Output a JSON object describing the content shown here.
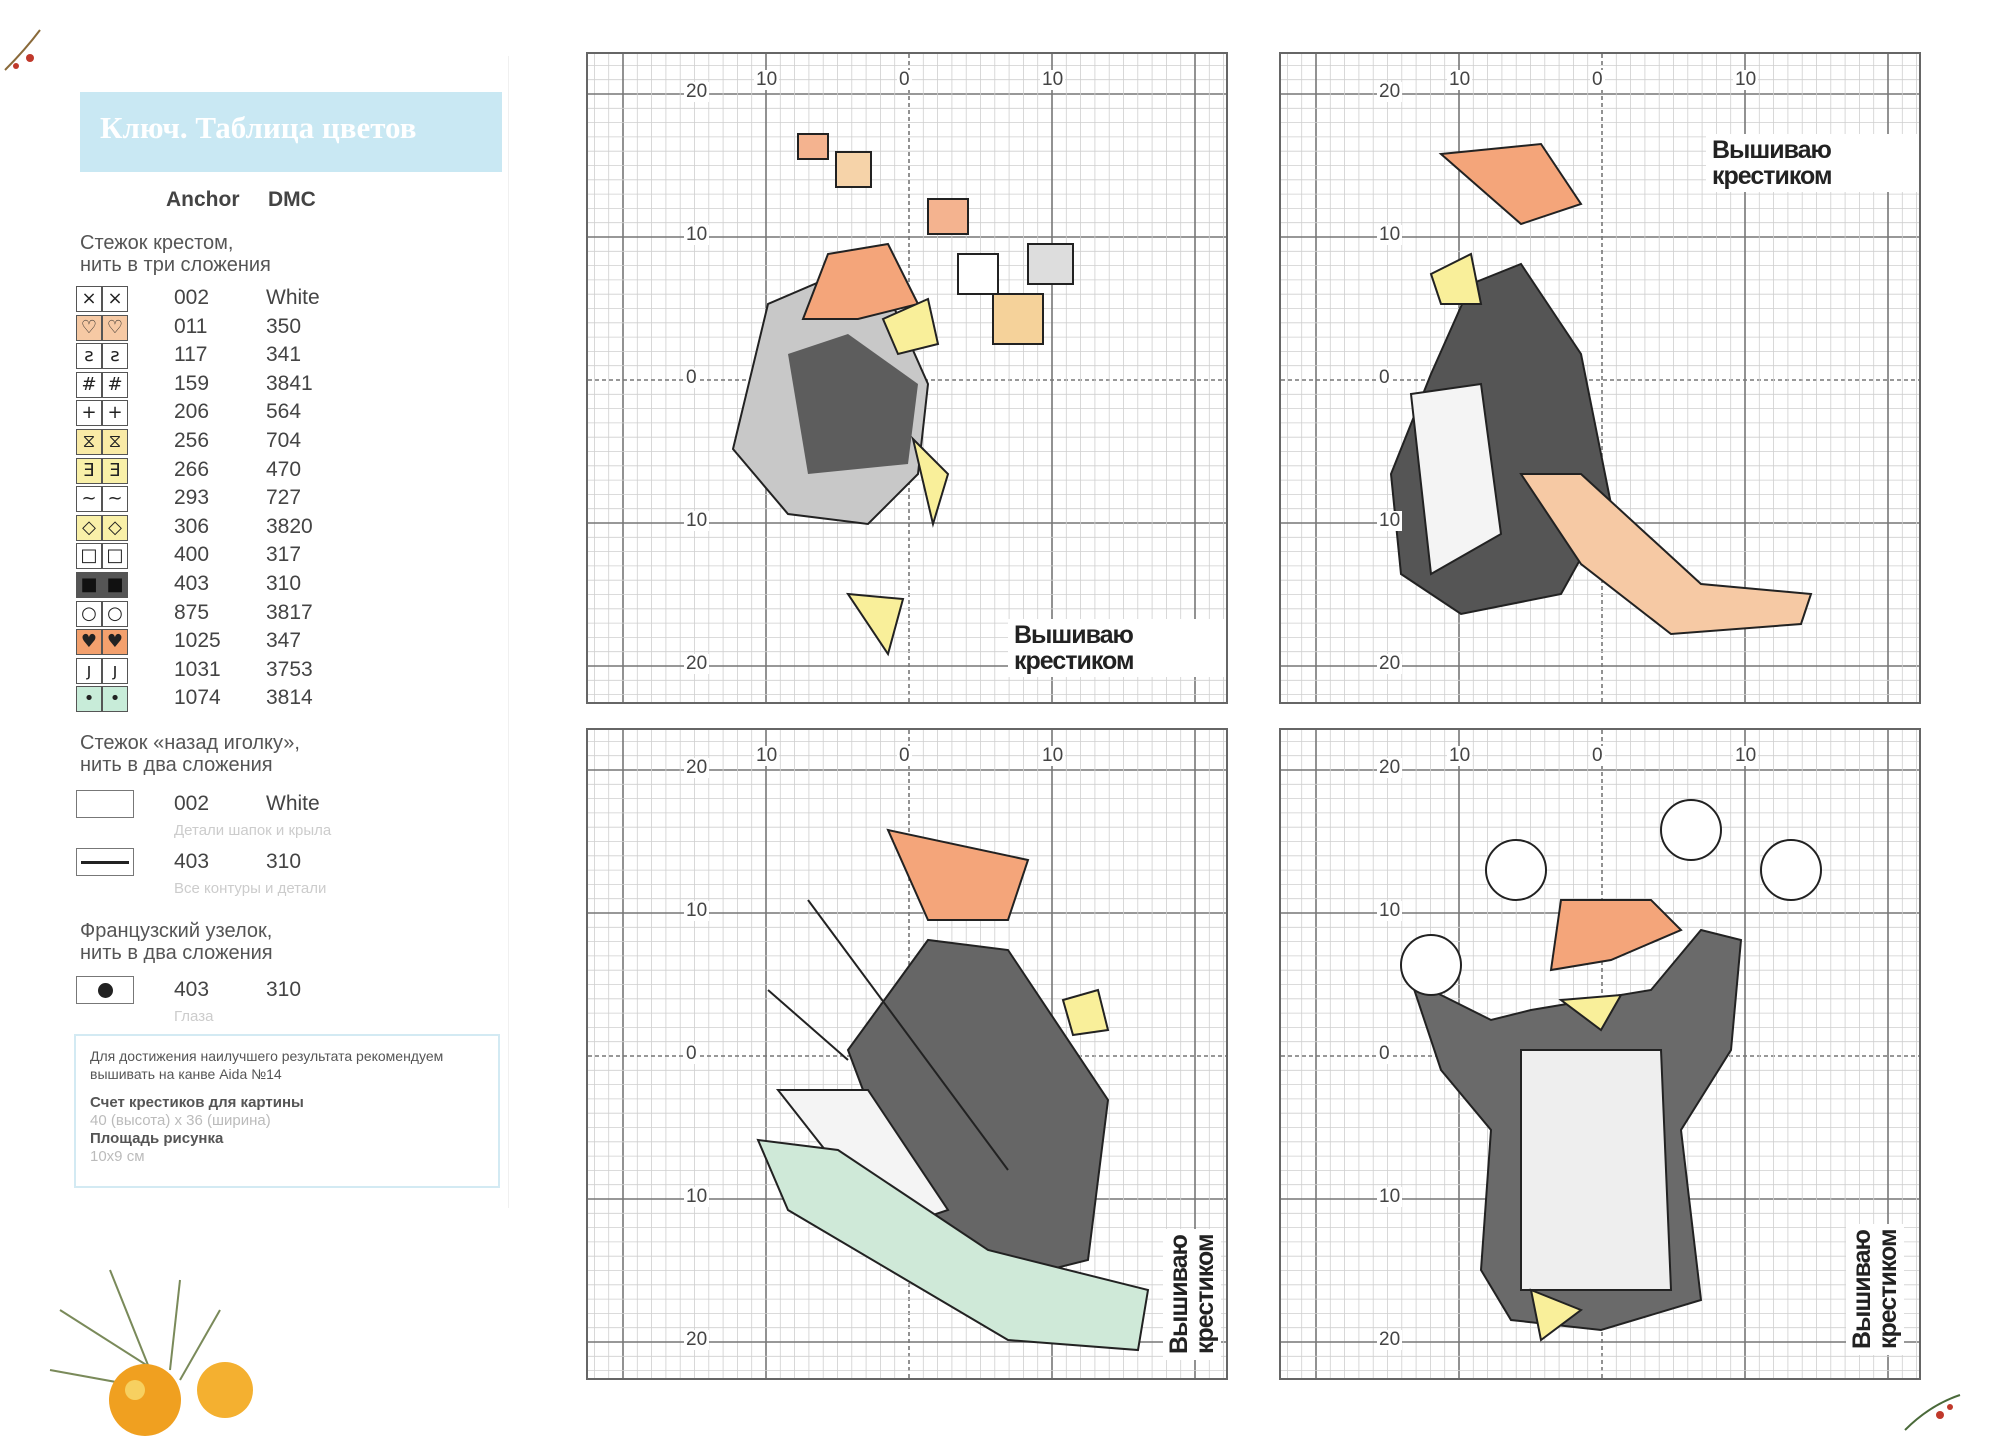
{
  "key": {
    "title": "Ключ. Таблица цветов",
    "col_anchor": "Anchor",
    "col_dmc": "DMC",
    "cross_heading_1": "Стежок крестом,",
    "cross_heading_2": "нить в три сложения",
    "rows": [
      {
        "sym": "×",
        "bg": "#ffffff",
        "anchor": "002",
        "dmc": "White"
      },
      {
        "sym": "♡",
        "bg": "#f6c9a4",
        "anchor": "011",
        "dmc": "350"
      },
      {
        "sym": "ƨ",
        "bg": "#ffffff",
        "anchor": "117",
        "dmc": "341"
      },
      {
        "sym": "#",
        "bg": "#ffffff",
        "anchor": "159",
        "dmc": "3841"
      },
      {
        "sym": "+",
        "bg": "#ffffff",
        "anchor": "206",
        "dmc": "564"
      },
      {
        "sym": "⧖",
        "bg": "#f9eaa6",
        "anchor": "256",
        "dmc": "704"
      },
      {
        "sym": "Ǝ",
        "bg": "#f9f0a8",
        "anchor": "266",
        "dmc": "470"
      },
      {
        "sym": "~",
        "bg": "#ffffff",
        "anchor": "293",
        "dmc": "727"
      },
      {
        "sym": "◇",
        "bg": "#f9f0a8",
        "anchor": "306",
        "dmc": "3820"
      },
      {
        "sym": "□",
        "bg": "#ffffff",
        "anchor": "400",
        "dmc": "317"
      },
      {
        "sym": "■",
        "bg": "#555555",
        "anchor": "403",
        "dmc": "310"
      },
      {
        "sym": "○",
        "bg": "#ffffff",
        "anchor": "875",
        "dmc": "3817"
      },
      {
        "sym": "♥",
        "bg": "#f3a06d",
        "anchor": "1025",
        "dmc": "347"
      },
      {
        "sym": "ȷ",
        "bg": "#ffffff",
        "anchor": "1031",
        "dmc": "3753"
      },
      {
        "sym": "•",
        "bg": "#c8ecd9",
        "anchor": "1074",
        "dmc": "3814"
      }
    ],
    "back_heading_1": "Стежок «назад иголку»,",
    "back_heading_2": "нить в два сложения",
    "back_rows": [
      {
        "anchor": "002",
        "dmc": "White",
        "note": "Детали шапок и крыла"
      },
      {
        "anchor": "403",
        "dmc": "310",
        "note": "Все контуры и детали"
      }
    ],
    "knot_heading_1": "Французский узелок,",
    "knot_heading_2": "нить в два сложения",
    "knot_row": {
      "anchor": "403",
      "dmc": "310",
      "note": "Глаза"
    },
    "info": {
      "line1": "Для достижения наилучшего результата рекомендуем",
      "line2": "вышивать на канве Aida №14",
      "count_title": "Счет крестиков для картины",
      "count_value": "40 (высота) x 36 (ширина)",
      "area_title": "Площадь рисунка",
      "area_value": "10x9 см"
    }
  },
  "charts": [
    {
      "x_labels": [
        "10",
        "0",
        "10"
      ],
      "y_labels": [
        "20",
        "10",
        "0",
        "10",
        "20"
      ],
      "logo": "Вышиваю крестиком"
    },
    {
      "x_labels": [
        "10",
        "0",
        "10"
      ],
      "y_labels": [
        "20",
        "10",
        "0",
        "10",
        "20"
      ],
      "logo": "Вышиваю крестиком"
    },
    {
      "x_labels": [
        "10",
        "0",
        "10"
      ],
      "y_labels": [
        "20",
        "10",
        "0",
        "10",
        "20"
      ],
      "logo": "Вышиваю крестиком"
    },
    {
      "x_labels": [
        "10",
        "0",
        "10"
      ],
      "y_labels": [
        "20",
        "10",
        "0",
        "10",
        "20"
      ],
      "logo": "Вышиваю крестиком"
    }
  ]
}
